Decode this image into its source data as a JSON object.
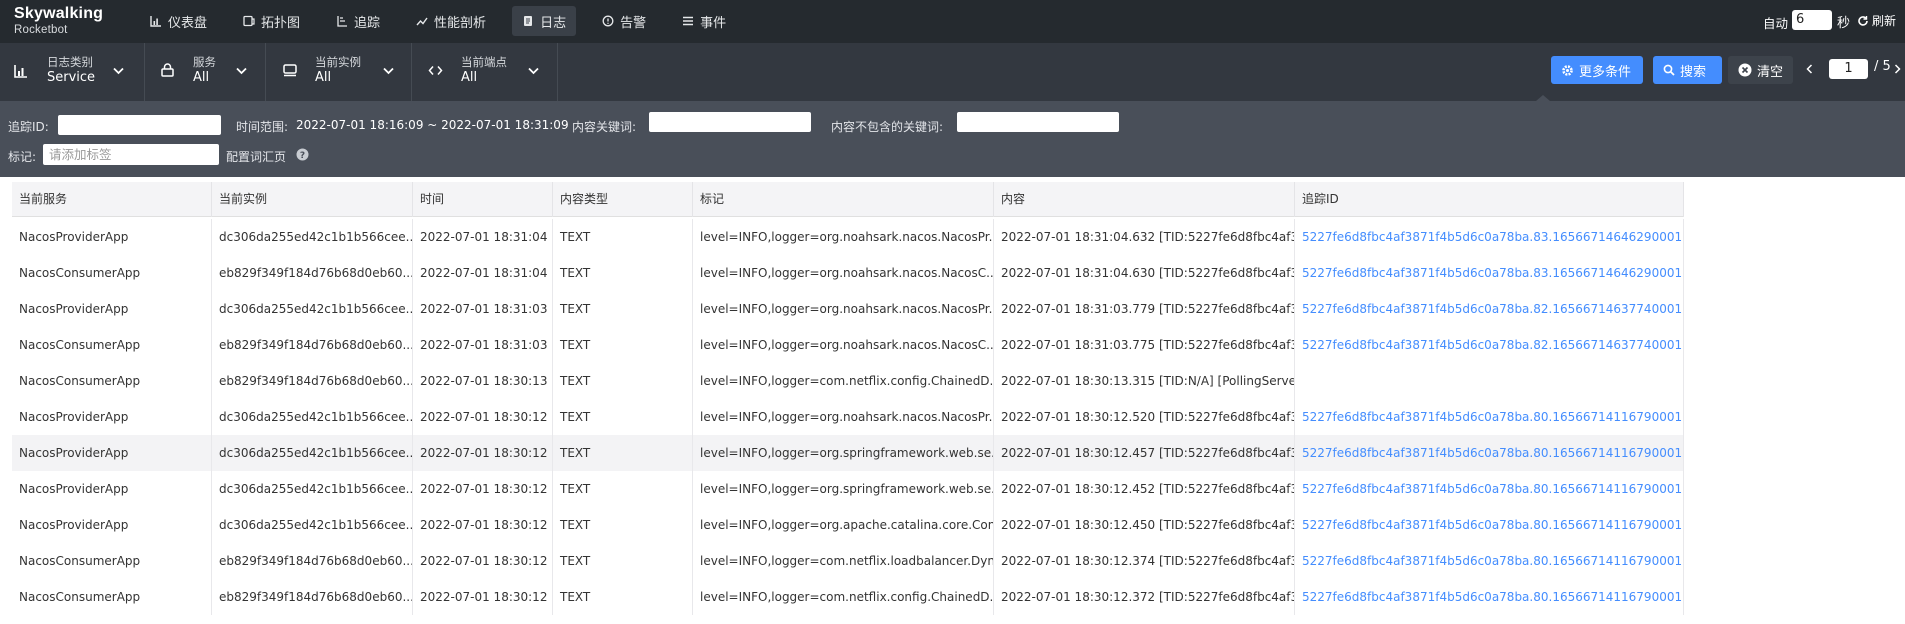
{
  "app": {
    "logo_line1": "Skywalking",
    "logo_line2": "Rocketbot"
  },
  "nav": [
    {
      "label": "仪表盘",
      "icon": "dashboard-icon"
    },
    {
      "label": "拓扑图",
      "icon": "topology-icon"
    },
    {
      "label": "追踪",
      "icon": "trace-icon"
    },
    {
      "label": "性能剖析",
      "icon": "profile-icon"
    },
    {
      "label": "日志",
      "icon": "log-icon",
      "active": true
    },
    {
      "label": "告警",
      "icon": "alarm-icon"
    },
    {
      "label": "事件",
      "icon": "event-icon"
    }
  ],
  "auto_refresh": {
    "label": "自动",
    "interval": "6",
    "unit": "秒",
    "refresh_label": "刷新"
  },
  "selectors": [
    {
      "label": "日志类别",
      "value": "Service",
      "icon": "chart-icon"
    },
    {
      "label": "服务",
      "value": "All",
      "icon": "lock-icon"
    },
    {
      "label": "当前实例",
      "value": "All",
      "icon": "instance-icon"
    },
    {
      "label": "当前端点",
      "value": "All",
      "icon": "code-icon"
    }
  ],
  "actions": {
    "more": "更多条件",
    "search": "搜索",
    "clear": "清空"
  },
  "pager": {
    "current": "1",
    "total": "/ 5"
  },
  "filters": {
    "trace_label": "追踪ID:",
    "trace_value": "",
    "time_label": "时间范围:",
    "time_value": "2022-07-01 18:16:09 ~ 2022-07-01 18:31:09",
    "keyword_label": "内容关键词:",
    "keyword_value": "",
    "exclude_label": "内容不包含的关键词:",
    "exclude_value": "",
    "tag_label": "标记:",
    "tag_placeholder": "请添加标签",
    "config_label": "配置词汇页"
  },
  "colors": {
    "accent": "#448dfe",
    "nav_bg": "#252a2f",
    "selector_bg": "#333840",
    "filter_bg": "#494f59"
  },
  "table": {
    "headers": [
      "当前服务",
      "当前实例",
      "时间",
      "内容类型",
      "标记",
      "内容",
      "追踪ID"
    ],
    "rows": [
      [
        "NacosProviderApp",
        "dc306da255ed42c1b1b566cee...",
        "2022-07-01 18:31:04",
        "TEXT",
        "level=INFO,logger=org.noahsark.nacos.NacosPr...",
        "2022-07-01 18:31:04.632 [TID:5227fe6d8fbc4af3...",
        "5227fe6d8fbc4af3871f4b5d6c0a78ba.83.16566714646290001"
      ],
      [
        "NacosConsumerApp",
        "eb829f349f184d76b68d0eb60...",
        "2022-07-01 18:31:04",
        "TEXT",
        "level=INFO,logger=org.noahsark.nacos.NacosC...",
        "2022-07-01 18:31:04.630 [TID:5227fe6d8fbc4af3...",
        "5227fe6d8fbc4af3871f4b5d6c0a78ba.83.16566714646290001"
      ],
      [
        "NacosProviderApp",
        "dc306da255ed42c1b1b566cee...",
        "2022-07-01 18:31:03",
        "TEXT",
        "level=INFO,logger=org.noahsark.nacos.NacosPr...",
        "2022-07-01 18:31:03.779 [TID:5227fe6d8fbc4af3...",
        "5227fe6d8fbc4af3871f4b5d6c0a78ba.82.16566714637740001"
      ],
      [
        "NacosConsumerApp",
        "eb829f349f184d76b68d0eb60...",
        "2022-07-01 18:31:03",
        "TEXT",
        "level=INFO,logger=org.noahsark.nacos.NacosC...",
        "2022-07-01 18:31:03.775 [TID:5227fe6d8fbc4af3...",
        "5227fe6d8fbc4af3871f4b5d6c0a78ba.82.16566714637740001"
      ],
      [
        "NacosConsumerApp",
        "eb829f349f184d76b68d0eb60...",
        "2022-07-01 18:30:13",
        "TEXT",
        "level=INFO,logger=com.netflix.config.ChainedD...",
        "2022-07-01 18:30:13.315 [TID:N/A] [PollingServe...",
        ""
      ],
      [
        "NacosProviderApp",
        "dc306da255ed42c1b1b566cee...",
        "2022-07-01 18:30:12",
        "TEXT",
        "level=INFO,logger=org.noahsark.nacos.NacosPr...",
        "2022-07-01 18:30:12.520 [TID:5227fe6d8fbc4af3...",
        "5227fe6d8fbc4af3871f4b5d6c0a78ba.80.16566714116790001"
      ],
      [
        "NacosProviderApp",
        "dc306da255ed42c1b1b566cee...",
        "2022-07-01 18:30:12",
        "TEXT",
        "level=INFO,logger=org.springframework.web.se...",
        "2022-07-01 18:30:12.457 [TID:5227fe6d8fbc4af3...",
        "5227fe6d8fbc4af3871f4b5d6c0a78ba.80.16566714116790001"
      ],
      [
        "NacosProviderApp",
        "dc306da255ed42c1b1b566cee...",
        "2022-07-01 18:30:12",
        "TEXT",
        "level=INFO,logger=org.springframework.web.se...",
        "2022-07-01 18:30:12.452 [TID:5227fe6d8fbc4af3...",
        "5227fe6d8fbc4af3871f4b5d6c0a78ba.80.16566714116790001"
      ],
      [
        "NacosProviderApp",
        "dc306da255ed42c1b1b566cee...",
        "2022-07-01 18:30:12",
        "TEXT",
        "level=INFO,logger=org.apache.catalina.core.Con...",
        "2022-07-01 18:30:12.450 [TID:5227fe6d8fbc4af3...",
        "5227fe6d8fbc4af3871f4b5d6c0a78ba.80.16566714116790001"
      ],
      [
        "NacosConsumerApp",
        "eb829f349f184d76b68d0eb60...",
        "2022-07-01 18:30:12",
        "TEXT",
        "level=INFO,logger=com.netflix.loadbalancer.Dyn...",
        "2022-07-01 18:30:12.374 [TID:5227fe6d8fbc4af3...",
        "5227fe6d8fbc4af3871f4b5d6c0a78ba.80.16566714116790001"
      ],
      [
        "NacosConsumerApp",
        "eb829f349f184d76b68d0eb60...",
        "2022-07-01 18:30:12",
        "TEXT",
        "level=INFO,logger=com.netflix.config.ChainedD...",
        "2022-07-01 18:30:12.372 [TID:5227fe6d8fbc4af3...",
        "5227fe6d8fbc4af3871f4b5d6c0a78ba.80.16566714116790001"
      ]
    ]
  }
}
